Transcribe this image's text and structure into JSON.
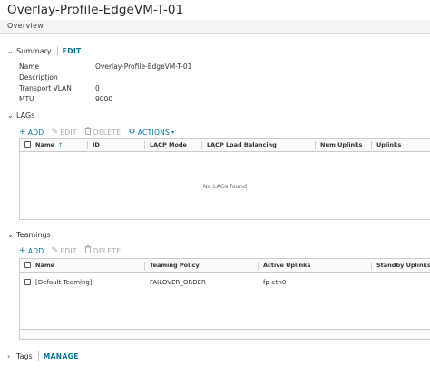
{
  "page": {
    "title": "Overlay-Profile-EdgeVM-T-01",
    "tab": "Overview"
  },
  "summary": {
    "title": "Summary",
    "edit_label": "EDIT",
    "fields": [
      {
        "label": "Name",
        "value": "Overlay-Profile-EdgeVM-T-01"
      },
      {
        "label": "Description",
        "value": ""
      },
      {
        "label": "Transport VLAN",
        "value": "0"
      },
      {
        "label": "MTU",
        "value": "9000"
      }
    ]
  },
  "lags": {
    "title": "LAGs",
    "toolbar": {
      "add": "ADD",
      "edit": "EDIT",
      "delete": "DELETE",
      "actions": "ACTIONS"
    },
    "columns": [
      "Name",
      "ID",
      "LACP Mode",
      "LACP Load Balancing",
      "Num Uplinks",
      "Uplinks"
    ],
    "empty_text": "No LAGs found"
  },
  "teamings": {
    "title": "Teamings",
    "toolbar": {
      "add": "ADD",
      "edit": "EDIT",
      "delete": "DELETE"
    },
    "columns": [
      "Name",
      "Teaming Policy",
      "Active Uplinks",
      "Standby Uplinks"
    ],
    "rows": [
      {
        "name": "[Default Teaming]",
        "policy": "FAILOVER_ORDER",
        "active": "fp-eth0",
        "standby": ""
      }
    ]
  },
  "tags": {
    "title": "Tags",
    "manage_label": "MANAGE"
  },
  "icons": {
    "expanded": "chevron-down-icon",
    "collapsed": "chevron-right-icon",
    "add": "plus-icon",
    "edit": "pencil-icon",
    "delete": "trash-icon",
    "actions": "gear-icon",
    "sort": "sort-up-icon"
  },
  "colors": {
    "link": "#0072a3",
    "disabled": "#a8a8a8",
    "border": "#cccccc"
  }
}
